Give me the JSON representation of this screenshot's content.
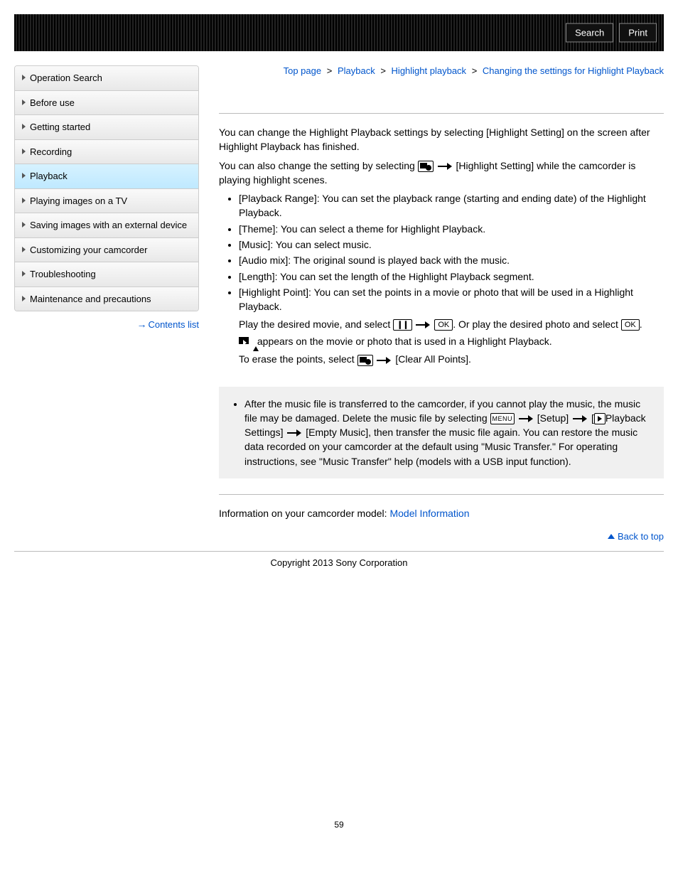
{
  "topbar": {
    "search": "Search",
    "print": "Print"
  },
  "breadcrumb": {
    "items": [
      "Top page",
      "Playback",
      "Highlight playback",
      "Changing the settings for Highlight Playback"
    ],
    "sep": ">"
  },
  "sidebar": {
    "items": [
      {
        "label": "Operation Search",
        "active": false
      },
      {
        "label": "Before use",
        "active": false
      },
      {
        "label": "Getting started",
        "active": false
      },
      {
        "label": "Recording",
        "active": false
      },
      {
        "label": "Playback",
        "active": true
      },
      {
        "label": "Playing images on a TV",
        "active": false
      },
      {
        "label": "Saving images with an external device",
        "active": false
      },
      {
        "label": "Customizing your camcorder",
        "active": false
      },
      {
        "label": "Troubleshooting",
        "active": false
      },
      {
        "label": "Maintenance and precautions",
        "active": false
      }
    ],
    "contents_list": "Contents list"
  },
  "intro": {
    "p1": "You can change the Highlight Playback settings by selecting [Highlight Setting] on the screen after Highlight Playback has finished.",
    "p2a": "You can also change the setting by selecting ",
    "p2b": " [Highlight Setting] while the camcorder is playing highlight scenes."
  },
  "bul": {
    "b0": "[Playback Range]: You can set the playback range (starting and ending date) of the Highlight Playback.",
    "b1": "[Theme]: You can select a theme for Highlight Playback.",
    "b2": "[Music]: You can select music.",
    "b3": "[Audio mix]: The original sound is played back with the music.",
    "b4": "[Length]: You can set the length of the Highlight Playback segment.",
    "b5": "[Highlight Point]: You can set the points in a movie or photo that will be used in a Highlight Playback.",
    "hp1a": "Play the desired movie, and select ",
    "hp1b": ". Or play the desired photo and select ",
    "hp1c": ".",
    "hp2": " appears on the movie or photo that is used in a Highlight Playback.",
    "hp3a": "To erase the points, select ",
    "hp3b": " [Clear All Points]."
  },
  "note": {
    "n1a": "After the music file is transferred to the camcorder, if you cannot play the music, the music file may be damaged. Delete the music file by selecting ",
    "n1b": " [Setup] ",
    "n1c": " [",
    "n1d": "Playback Settings] ",
    "n1e": "[Empty Music], then transfer the music file again. You can restore the music data recorded on your camcorder at the default using \"Music Transfer.\" For operating instructions, see \"Music Transfer\" help (models with a USB input function)."
  },
  "model": {
    "prefix": "Information on your camcorder model: ",
    "link": "Model Information"
  },
  "backtop": "Back to top",
  "copyright": "Copyright 2013 Sony Corporation",
  "page_number": "59",
  "labels": {
    "ok": "OK",
    "menu": "MENU",
    "pause": "❙❙"
  }
}
